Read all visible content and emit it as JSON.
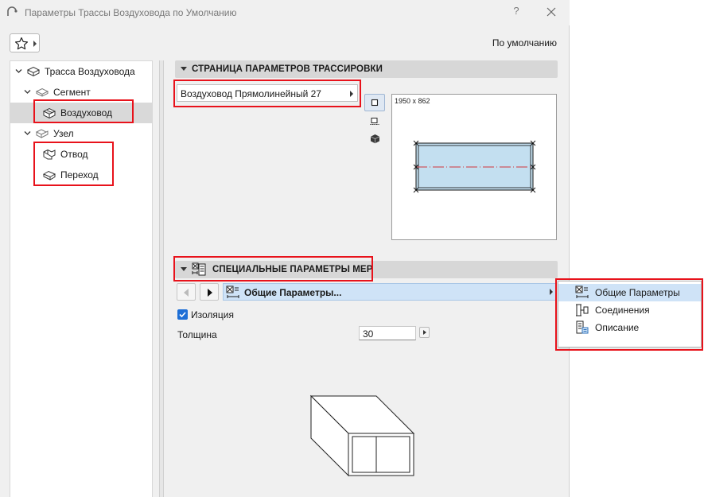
{
  "window": {
    "title": "Параметры Трассы Воздуховода по Умолчанию",
    "help_label": "?"
  },
  "toolbar": {
    "default_label": "По умолчанию"
  },
  "tree": {
    "items": [
      {
        "label": "Трасса Воздуховода",
        "icon": "route-icon"
      },
      {
        "label": "Сегмент",
        "icon": "segment-icon"
      },
      {
        "label": "Воздуховод",
        "icon": "duct-icon",
        "selected": true
      },
      {
        "label": "Узел",
        "icon": "node-icon"
      },
      {
        "label": "Отвод",
        "icon": "elbow-icon"
      },
      {
        "label": "Переход",
        "icon": "transition-icon"
      }
    ]
  },
  "routing_section": {
    "title": "СТРАНИЦА ПАРАМЕТРОВ ТРАССИРОВКИ",
    "element_type": "Воздуховод Прямолинейный 27",
    "preview_dims": "1950 x 862",
    "view_buttons": [
      "plan-view-icon",
      "section-view-icon",
      "3d-view-icon"
    ]
  },
  "mep_section": {
    "title": "СПЕЦИАЛЬНЫЕ ПАРАМЕТРЫ MEP",
    "current_panel": "Общие Параметры...",
    "insulation_label": "Изоляция",
    "insulation_checked": true,
    "thickness_label": "Толщина",
    "thickness_value": "30"
  },
  "panel_menu": {
    "items": [
      {
        "label": "Общие Параметры",
        "icon": "general-params-icon",
        "hover": true
      },
      {
        "label": "Соединения",
        "icon": "connections-icon"
      },
      {
        "label": "Описание",
        "icon": "description-icon"
      }
    ]
  },
  "colors": {
    "accent": "#1e6fd6",
    "highlight": "#e8121b",
    "selection": "#cfe3f7",
    "duct_fill": "#c3dff0",
    "centerline": "#d0343c"
  }
}
